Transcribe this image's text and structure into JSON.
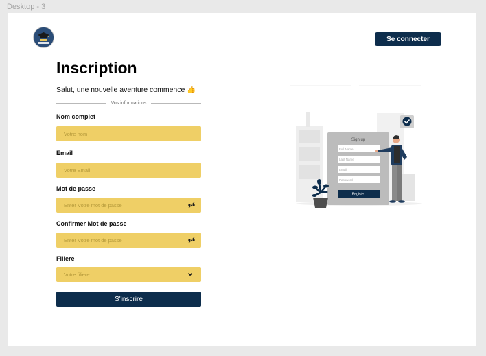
{
  "frame": {
    "label": "Desktop - 3"
  },
  "header": {
    "login_label": "Se connecter"
  },
  "form": {
    "title": "Inscription",
    "subtitle": "Salut, une nouvelle aventure commence 👍",
    "section_label": "Vos informations",
    "fields": {
      "fullname": {
        "label": "Nom complet",
        "placeholder": "Votre nom"
      },
      "email": {
        "label": "Email",
        "placeholder": "Votre Email"
      },
      "password": {
        "label": "Mot de passe",
        "placeholder": "Enter Votre mot de passe"
      },
      "confirm": {
        "label": "Confirmer Mot de passe",
        "placeholder": "Enter Votre mot de passe"
      },
      "filiere": {
        "label": "Filiere",
        "selected": "Votre filiere"
      }
    },
    "submit_label": "S'inscrire"
  },
  "illustration": {
    "card_title": "Sign up",
    "inputs": [
      "Full Name",
      "Last Name",
      "Email",
      "Password"
    ],
    "button_label": "Register"
  },
  "colors": {
    "primary": "#0d2d4c",
    "field_bg": "#efcf66",
    "placeholder": "#b59a3b",
    "canvas_bg": "#ffffff",
    "page_bg": "#e9e9e9"
  },
  "icons": {
    "logo": "school-logo",
    "eye_toggle": "eye-off-icon",
    "dropdown": "chevron-down-icon",
    "check": "check-circle-icon"
  }
}
